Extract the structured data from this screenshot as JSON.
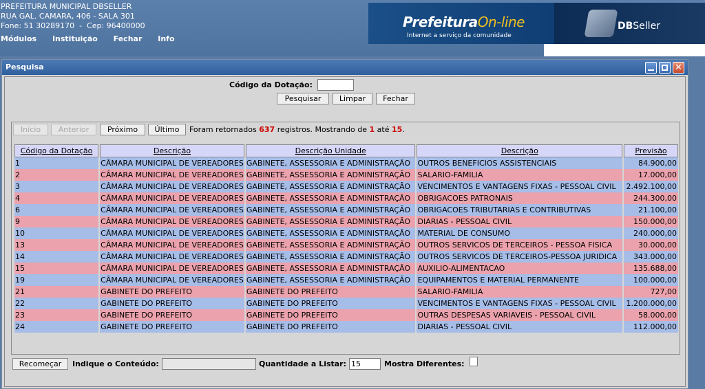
{
  "header": {
    "org": "PREFEITURA MUNICIPAL DBSELLER",
    "address": "RUA GAL. CAMARA, 406 - SALA 301",
    "contact": "Fone: 51 30289170  -  Cep: 96400000",
    "menu": [
      "Módulos",
      "Instituição",
      "Fechar",
      "Info"
    ],
    "banner_title_a": "Prefeitura",
    "banner_title_b": "On-line",
    "banner_sub": "Internet a serviço da comunidade",
    "brand_a": "DB",
    "brand_b": "Seller"
  },
  "window": {
    "title": "Pesquisa",
    "close_glyph": "✕"
  },
  "search": {
    "label": "Código da Dotação:",
    "value": "",
    "buttons": {
      "search": "Pesquisar",
      "clear": "Limpar",
      "close": "Fechar"
    }
  },
  "pager": {
    "first": "Início",
    "prev": "Anterior",
    "next": "Próximo",
    "last": "Último",
    "text_a": "Foram retornados",
    "total": "637",
    "text_b": "registros. Mostrando de",
    "from": "1",
    "text_c": "até",
    "to": "15",
    "text_d": "."
  },
  "table": {
    "headers": [
      "Código da Dotação",
      "Descrição",
      "Descrição Unidade",
      "Descrição",
      "Previsão"
    ],
    "rows": [
      [
        "1",
        "CÂMARA MUNICIPAL DE VEREADORES",
        "GABINETE, ASSESSORIA E ADMINISTRAÇÃO",
        "OUTROS BENEFICIOS ASSISTENCIAIS",
        "84.900,00"
      ],
      [
        "2",
        "CÂMARA MUNICIPAL DE VEREADORES",
        "GABINETE, ASSESSORIA E ADMINISTRAÇÃO",
        "SALARIO-FAMILIA",
        "17.000,00"
      ],
      [
        "3",
        "CÂMARA MUNICIPAL DE VEREADORES",
        "GABINETE, ASSESSORIA E ADMINISTRAÇÃO",
        "VENCIMENTOS E VANTAGENS FIXAS - PESSOAL CIVIL",
        "2.492.100,00"
      ],
      [
        "4",
        "CÂMARA MUNICIPAL DE VEREADORES",
        "GABINETE, ASSESSORIA E ADMINISTRAÇÃO",
        "OBRIGACOES PATRONAIS",
        "244.300,00"
      ],
      [
        "6",
        "CÂMARA MUNICIPAL DE VEREADORES",
        "GABINETE, ASSESSORIA E ADMINISTRAÇÃO",
        "OBRIGACOES TRIBUTARIAS E CONTRIBUTIVAS",
        "21.100,00"
      ],
      [
        "9",
        "CÂMARA MUNICIPAL DE VEREADORES",
        "GABINETE, ASSESSORIA E ADMINISTRAÇÃO",
        "DIARIAS - PESSOAL CIVIL",
        "150.000,00"
      ],
      [
        "10",
        "CÂMARA MUNICIPAL DE VEREADORES",
        "GABINETE, ASSESSORIA E ADMINISTRAÇÃO",
        "MATERIAL DE CONSUMO",
        "240.000,00"
      ],
      [
        "13",
        "CÂMARA MUNICIPAL DE VEREADORES",
        "GABINETE, ASSESSORIA E ADMINISTRAÇÃO",
        "OUTROS SERVICOS DE TERCEIROS - PESSOA FISICA",
        "30.000,00"
      ],
      [
        "14",
        "CÂMARA MUNICIPAL DE VEREADORES",
        "GABINETE, ASSESSORIA E ADMINISTRAÇÃO",
        "OUTROS SERVICOS DE TERCEIROS-PESSOA JURIDICA",
        "343.000,00"
      ],
      [
        "15",
        "CÂMARA MUNICIPAL DE VEREADORES",
        "GABINETE, ASSESSORIA E ADMINISTRAÇÃO",
        "AUXILIO-ALIMENTACAO",
        "135.688,00"
      ],
      [
        "19",
        "CÂMARA MUNICIPAL DE VEREADORES",
        "GABINETE, ASSESSORIA E ADMINISTRAÇÃO",
        "EQUIPAMENTOS E MATERIAL PERMANENTE",
        "100.000,00"
      ],
      [
        "21",
        "GABINETE DO PREFEITO",
        "GABINETE DO PREFEITO",
        "SALARIO-FAMILIA",
        "727,00"
      ],
      [
        "22",
        "GABINETE DO PREFEITO",
        "GABINETE DO PREFEITO",
        "VENCIMENTOS E VANTAGENS FIXAS - PESSOAL CIVIL",
        "1.200.000,00"
      ],
      [
        "23",
        "GABINETE DO PREFEITO",
        "GABINETE DO PREFEITO",
        "OUTRAS DESPESAS VARIAVEIS - PESSOAL CIVIL",
        "58.000,00"
      ],
      [
        "24",
        "GABINETE DO PREFEITO",
        "GABINETE DO PREFEITO",
        "DIARIAS - PESSOAL CIVIL",
        "112.000,00"
      ]
    ]
  },
  "footer": {
    "restart": "Recomeçar",
    "content_label": "Indique o Conteúdo:",
    "content_value": "",
    "qty_label": "Quantidade a Listar:",
    "qty_value": "15",
    "diff_label": "Mostra Diferentes:"
  }
}
